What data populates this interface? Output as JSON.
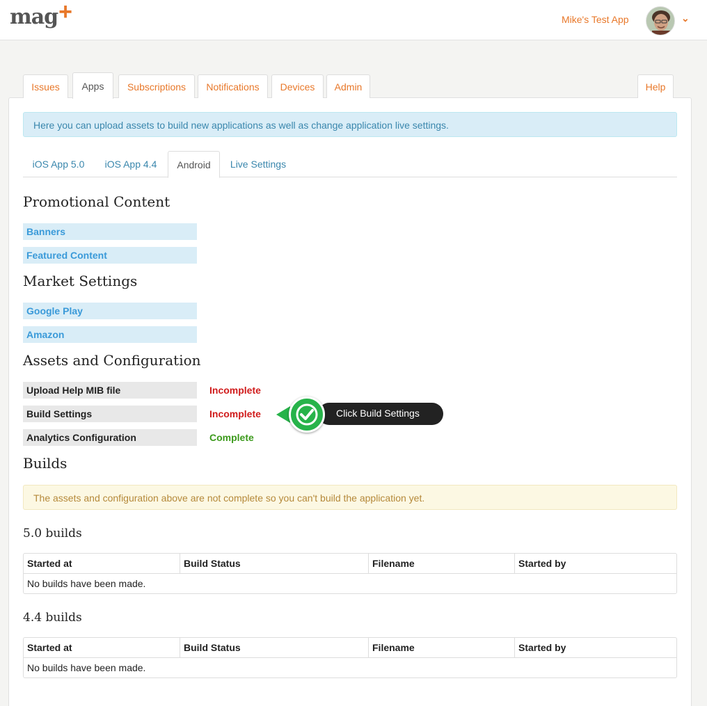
{
  "header": {
    "logo_text": "mag",
    "logo_plus": "+",
    "app_name": "Mike's Test App",
    "avatar_icon": "user-avatar",
    "caret_icon": "chevron-down-icon"
  },
  "main_tabs": [
    {
      "label": "Issues"
    },
    {
      "label": "Apps"
    },
    {
      "label": "Subscriptions"
    },
    {
      "label": "Notifications"
    },
    {
      "label": "Devices"
    },
    {
      "label": "Admin"
    },
    {
      "label": "Help"
    }
  ],
  "info_message": "Here you can upload assets to build new applications as well as change application live settings.",
  "sub_tabs": [
    {
      "label": "iOS App 5.0"
    },
    {
      "label": "iOS App 4.4"
    },
    {
      "label": "Android"
    },
    {
      "label": "Live Settings"
    }
  ],
  "promotional": {
    "title": "Promotional Content",
    "items": [
      "Banners",
      "Featured Content"
    ]
  },
  "market": {
    "title": "Market Settings",
    "items": [
      "Google Play",
      "Amazon"
    ]
  },
  "assets": {
    "title": "Assets and Configuration",
    "items": [
      {
        "label": "Upload Help MIB file",
        "status": "Incomplete"
      },
      {
        "label": "Build Settings",
        "status": "Incomplete"
      },
      {
        "label": "Analytics Configuration",
        "status": "Complete"
      }
    ]
  },
  "callout": {
    "text": "Click Build Settings",
    "icon": "check-icon"
  },
  "builds": {
    "title": "Builds",
    "warning": "The assets and configuration above are not complete so you can't build the application yet.",
    "tables": [
      {
        "title": "5.0 builds",
        "headers": [
          "Started at",
          "Build Status",
          "Filename",
          "Started by"
        ],
        "empty_text": "No builds have been made."
      },
      {
        "title": "4.4 builds",
        "headers": [
          "Started at",
          "Build Status",
          "Filename",
          "Started by"
        ],
        "empty_text": "No builds have been made."
      }
    ]
  },
  "colors": {
    "accent": "#e8782a",
    "link": "#3a9ad9",
    "incomplete": "#d01c1c",
    "complete": "#3c9a1c",
    "callout_green": "#27b34a"
  }
}
